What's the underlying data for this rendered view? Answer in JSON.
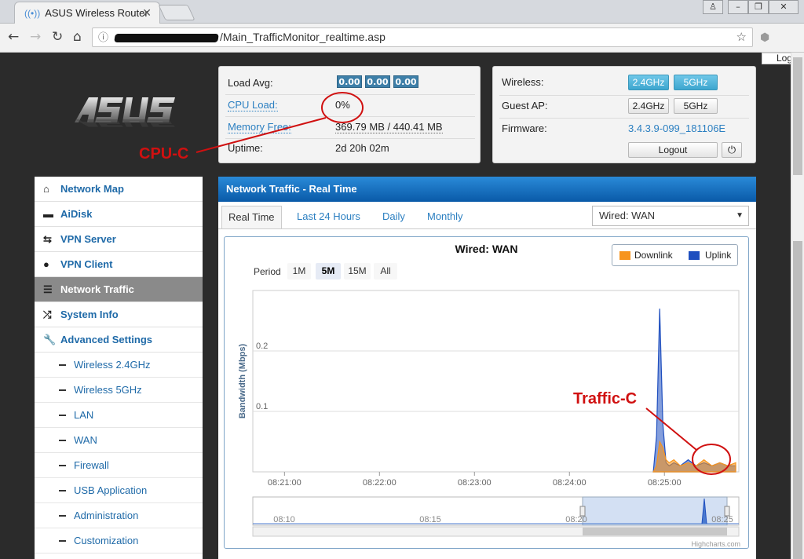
{
  "browser": {
    "tab_title": "ASUS Wireless Router",
    "url_path": "/Main_TrafficMonitor_realtime.asp",
    "partial_button": "Log"
  },
  "status": {
    "load_avg_label": "Load Avg:",
    "load_avg": [
      "0.00",
      "0.00",
      "0.00"
    ],
    "cpu_label": "CPU Load:",
    "cpu_value": "0%",
    "memory_label": "Memory Free:",
    "memory_value": "369.79 MB / 440.41 MB",
    "uptime_label": "Uptime:",
    "uptime_value": "2d 20h 02m"
  },
  "wireless": {
    "wireless_label": "Wireless:",
    "band_24": "2.4GHz",
    "band_5": "5GHz",
    "guest_label": "Guest AP:",
    "firmware_label": "Firmware:",
    "firmware_value": "3.4.3.9-099_181106E",
    "logout": "Logout"
  },
  "menu": {
    "items": [
      {
        "label": "Network Map",
        "icon": "home-icon"
      },
      {
        "label": "AiDisk",
        "icon": "disk-icon"
      },
      {
        "label": "VPN Server",
        "icon": "swap-icon"
      },
      {
        "label": "VPN Client",
        "icon": "globe-icon"
      },
      {
        "label": "Network Traffic",
        "icon": "list-icon",
        "active": true
      },
      {
        "label": "System Info",
        "icon": "shuffle-icon"
      },
      {
        "label": "Advanced Settings",
        "icon": "wrench-icon"
      }
    ],
    "sub": [
      "Wireless 2.4GHz",
      "Wireless 5GHz",
      "LAN",
      "WAN",
      "Firewall",
      "USB Application",
      "Administration",
      "Customization"
    ]
  },
  "main": {
    "header": "Network Traffic - Real Time",
    "tabs": [
      "Real Time",
      "Last 24 Hours",
      "Daily",
      "Monthly"
    ],
    "select_value": "Wired: WAN",
    "period_label": "Period",
    "period_buttons": [
      "1M",
      "5M",
      "15M",
      "All"
    ],
    "period_active": "5M",
    "credit": "Highcharts.com"
  },
  "annotations": {
    "cpu": "CPU-C",
    "traffic": "Traffic-C"
  },
  "colors": {
    "downlink": "#f7941d",
    "uplink": "#1f4fbf",
    "annotation": "#d01010",
    "header_blue": "#0a5aa8"
  },
  "chart_data": {
    "type": "area",
    "title": "Wired: WAN",
    "ylabel": "Bandwidth (Mbps)",
    "xlabel": "",
    "ylim": [
      0,
      0.3
    ],
    "yticks": [
      "0.1",
      "0.2"
    ],
    "xticks": [
      "08:21:00",
      "08:22:00",
      "08:23:00",
      "08:24:00",
      "08:25:00"
    ],
    "grid": true,
    "legend": "top-right",
    "series": [
      {
        "name": "Downlink",
        "color": "#f7941d",
        "x": [
          "08:24:53",
          "08:24:55",
          "08:24:57",
          "08:24:59",
          "08:25:01",
          "08:25:03",
          "08:25:06",
          "08:25:10",
          "08:25:15",
          "08:25:20",
          "08:25:25",
          "08:25:30",
          "08:25:35",
          "08:25:40",
          "08:25:45"
        ],
        "values": [
          0,
          0.01,
          0.05,
          0.04,
          0.02,
          0.015,
          0.02,
          0.01,
          0.015,
          0.01,
          0.02,
          0.01,
          0.015,
          0.01,
          0.015
        ]
      },
      {
        "name": "Uplink",
        "color": "#1f4fbf",
        "x": [
          "08:24:53",
          "08:24:55",
          "08:24:57",
          "08:24:59",
          "08:25:01",
          "08:25:03",
          "08:25:06",
          "08:25:10",
          "08:25:15",
          "08:25:20",
          "08:25:25",
          "08:25:30",
          "08:25:35",
          "08:25:40",
          "08:25:45"
        ],
        "values": [
          0,
          0.06,
          0.27,
          0.08,
          0.015,
          0.01,
          0.015,
          0.01,
          0.02,
          0.01,
          0.015,
          0.01,
          0.015,
          0.01,
          0.01
        ]
      }
    ],
    "navigator_ticks": [
      "08:10",
      "08:15",
      "08:20",
      "08:25"
    ]
  }
}
